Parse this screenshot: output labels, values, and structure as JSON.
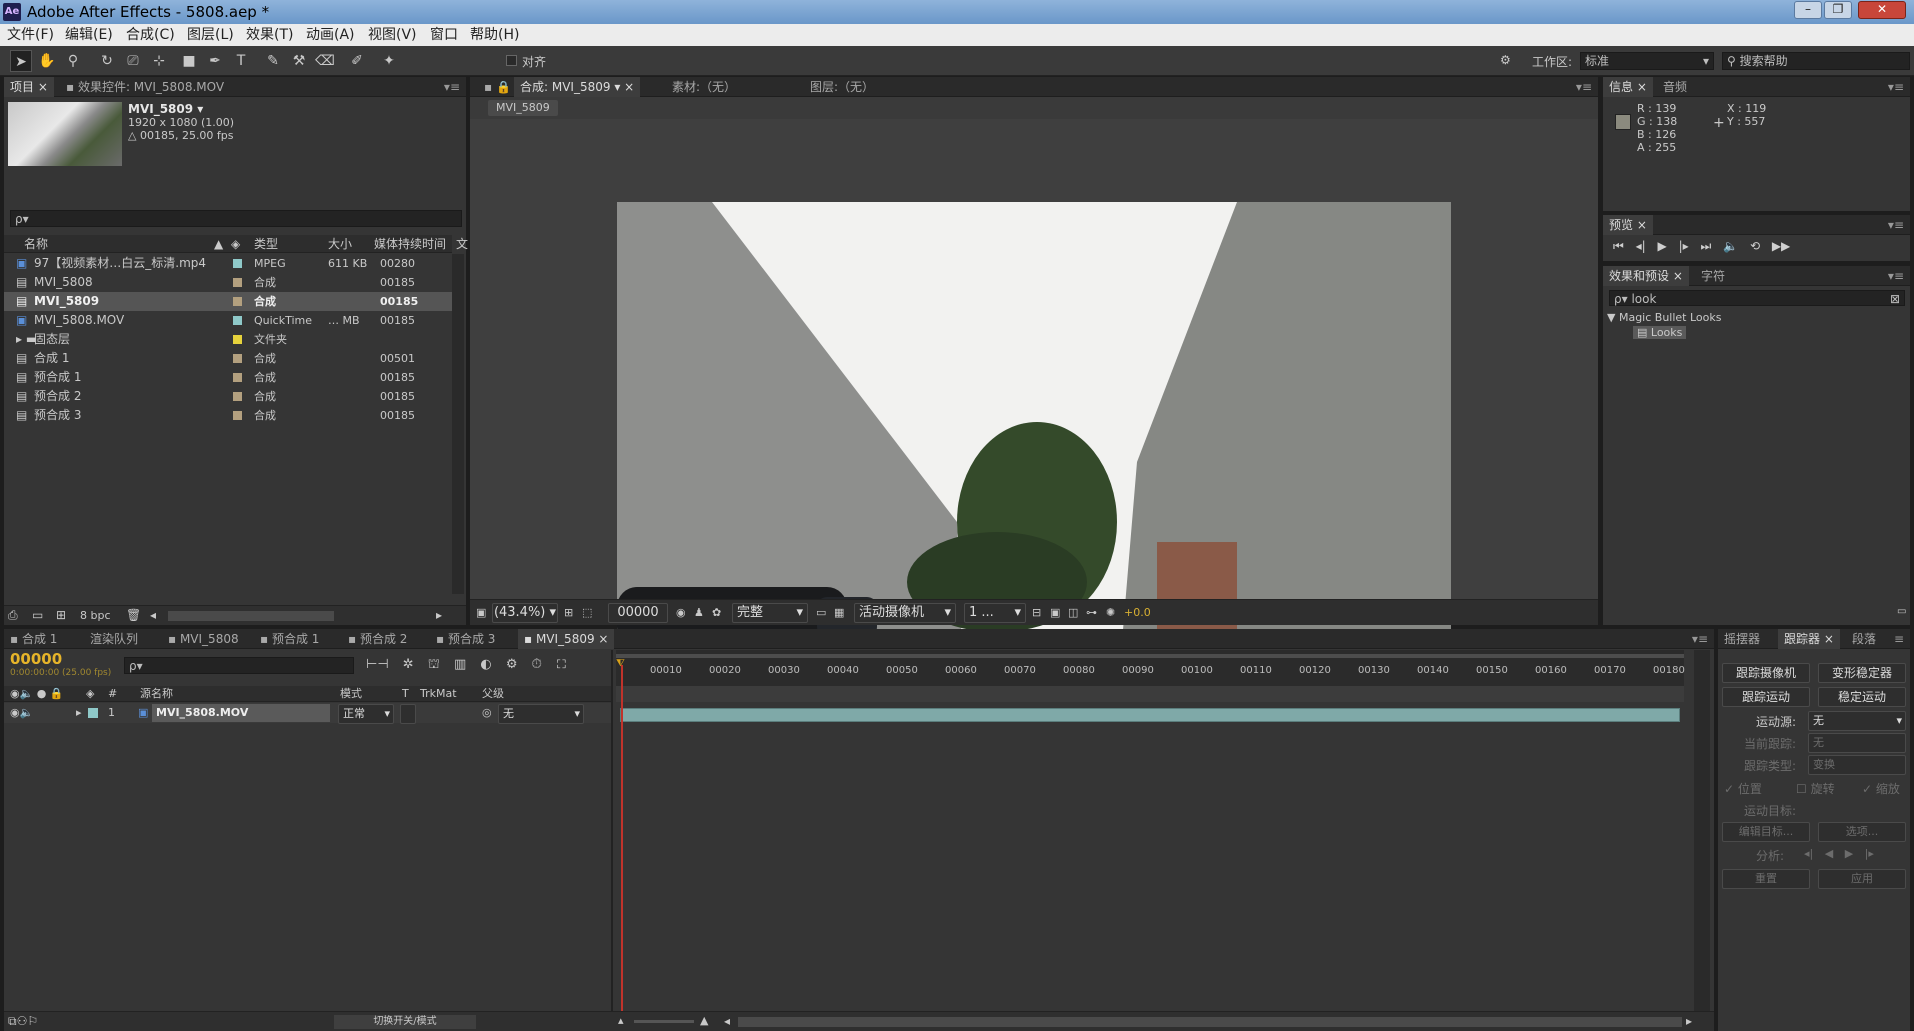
{
  "app": {
    "icon": "Ae",
    "title": "Adobe After Effects - 5808.aep *"
  },
  "window_controls": {
    "minimize": "–",
    "restore": "❐",
    "close": "✕"
  },
  "menu": [
    "文件(F)",
    "编辑(E)",
    "合成(C)",
    "图层(L)",
    "效果(T)",
    "动画(A)",
    "视图(V)",
    "窗口",
    "帮助(H)"
  ],
  "toolbar": {
    "snap_label": "对齐",
    "workspace_label": "工作区:",
    "workspace_value": "标准",
    "search_help": "搜索帮助"
  },
  "project_panel": {
    "tab": "项目",
    "effects_tab": "效果控件: MVI_5808.MOV",
    "thumb_name": "MVI_5809 ▾",
    "thumb_res": "1920 x 1080 (1.00)",
    "thumb_dur": "△ 00185, 25.00 fps",
    "search_placeholder": "ρ▾",
    "headers": {
      "name": "名称",
      "type": "类型",
      "size": "大小",
      "duration": "媒体持续时间",
      "extra": "文"
    },
    "items": [
      {
        "name": "97【视频素材…白云_标清.mp4",
        "type": "MPEG",
        "size": "611 KB",
        "dur": "00280",
        "color": "#8fc9c9",
        "icon": "file-icon"
      },
      {
        "name": "MVI_5808",
        "type": "合成",
        "size": "",
        "dur": "00185",
        "color": "#b3a07f",
        "icon": "comp-icon"
      },
      {
        "name": "MVI_5809",
        "type": "合成",
        "size": "",
        "dur": "00185",
        "color": "#b3a07f",
        "icon": "comp-icon"
      },
      {
        "name": "MVI_5808.MOV",
        "type": "QuickTime",
        "size": "… MB",
        "dur": "00185",
        "color": "#8fc9c9",
        "icon": "file-icon"
      },
      {
        "name": "固态层",
        "type": "文件夹",
        "size": "",
        "dur": "",
        "color": "#e6d23c",
        "icon": "folder-icon"
      },
      {
        "name": "合成 1",
        "type": "合成",
        "size": "",
        "dur": "00501",
        "color": "#b3a07f",
        "icon": "comp-icon"
      },
      {
        "name": "预合成 1",
        "type": "合成",
        "size": "",
        "dur": "00185",
        "color": "#b3a07f",
        "icon": "comp-icon"
      },
      {
        "name": "预合成 2",
        "type": "合成",
        "size": "",
        "dur": "00185",
        "color": "#b3a07f",
        "icon": "comp-icon"
      },
      {
        "name": "预合成 3",
        "type": "合成",
        "size": "",
        "dur": "00185",
        "color": "#b3a07f",
        "icon": "comp-icon"
      }
    ],
    "bpc": "8 bpc"
  },
  "comp_panel": {
    "tab_comp": "合成: MVI_5809",
    "tab_footage": "素材:（无）",
    "tab_layer": "图层:（无）",
    "crumb": "MVI_5809",
    "zoom": "(43.4%)",
    "timecode": "00000",
    "resolution": "完整",
    "camera": "活动摄像机",
    "views": "1 ...",
    "exposure": "+0.0"
  },
  "info_panel": {
    "tab": "信息",
    "audio_tab": "音频",
    "r": "R : 139",
    "g": "G : 138",
    "b": "B : 126",
    "a": "A : 255",
    "x": "X : 119",
    "y": "Y : 557"
  },
  "preview_panel": {
    "tab": "预览"
  },
  "effects_panel": {
    "tab": "效果和预设",
    "char_tab": "字符",
    "search": "look",
    "group": "Magic Bullet Looks",
    "item": "Looks"
  },
  "timeline": {
    "tabs": [
      "合成 1",
      "渲染队列",
      "MVI_5808",
      "预合成 1",
      "预合成 2",
      "预合成 3",
      "MVI_5809"
    ],
    "timecode": "00000",
    "timecode_sub": "0:00:00:00 (25.00 fps)",
    "search_placeholder": "ρ▾",
    "columns": {
      "num": "#",
      "source": "源名称",
      "mode": "模式",
      "t": "T",
      "trkmat": "TrkMat",
      "parent": "父级"
    },
    "ruler": [
      "00010",
      "00020",
      "00030",
      "00040",
      "00050",
      "00060",
      "00070",
      "00080",
      "00090",
      "00100",
      "00110",
      "00120",
      "00130",
      "00140",
      "00150",
      "00160",
      "00170",
      "00180"
    ],
    "layer": {
      "index": "1",
      "name": "MVI_5808.MOV",
      "mode": "正常",
      "parent": "无"
    },
    "bottom_label": "切换开关/模式"
  },
  "tracker": {
    "tabs": [
      "摇摆器",
      "跟踪器",
      "段落"
    ],
    "btn_track_camera": "跟踪摄像机",
    "btn_warp_stab": "变形稳定器",
    "btn_track_motion": "跟踪运动",
    "btn_stabilize": "稳定运动",
    "source_label": "运动源:",
    "source_value": "无",
    "current_label": "当前跟踪:",
    "current_value": "无",
    "type_label": "跟踪类型:",
    "type_value": "变换",
    "pos": "位置",
    "rot": "旋转",
    "scale": "缩放",
    "target_label": "运动目标:",
    "edit_target": "编辑目标...",
    "options": "选项...",
    "analyze": "分析:",
    "reset": "重置",
    "apply": "应用"
  }
}
